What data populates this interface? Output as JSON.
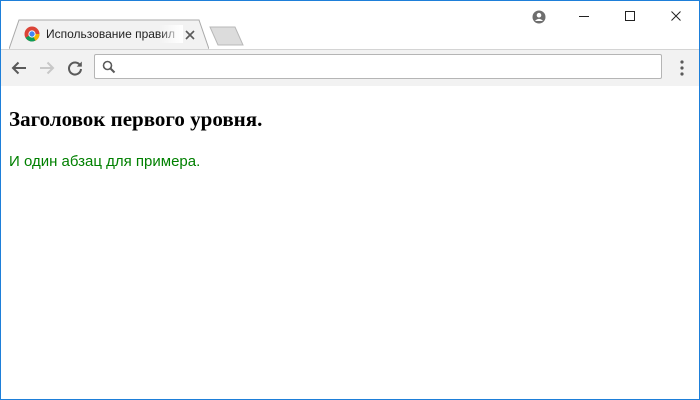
{
  "browser": {
    "tab": {
      "title": "Использование правил",
      "favicon": "chrome-favicon-icon",
      "close_icon": "close-icon"
    },
    "new_tab_icon": "new-tab-icon",
    "window_controls": [
      "profile-icon",
      "minimize-icon",
      "maximize-icon",
      "close-icon"
    ],
    "nav": [
      "back-arrow-icon",
      "forward-arrow-icon",
      "reload-icon"
    ],
    "address_bar": {
      "value": "",
      "icon": "search-icon"
    },
    "menu_icon": "kebab-menu-icon"
  },
  "page": {
    "heading": "Заголовок первого уровня.",
    "paragraph": "И один абзац для примера.",
    "paragraph_color": "#008000"
  },
  "colors": {
    "window_border": "#1e7fd9",
    "toolbar_bg": "#f2f2f2"
  }
}
